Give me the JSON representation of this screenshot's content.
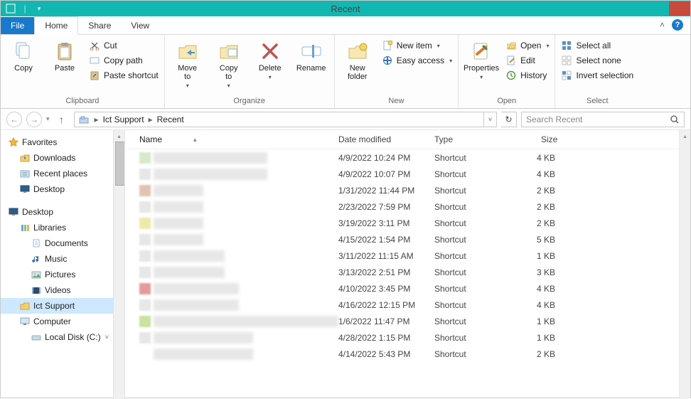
{
  "window": {
    "title": "Recent"
  },
  "tabs": {
    "file": "File",
    "home": "Home",
    "share": "Share",
    "view": "View"
  },
  "ribbon": {
    "clipboard": {
      "label": "Clipboard",
      "copy": "Copy",
      "paste": "Paste",
      "cut": "Cut",
      "copy_path": "Copy path",
      "paste_shortcut": "Paste shortcut"
    },
    "organize": {
      "label": "Organize",
      "move_to": "Move\nto",
      "copy_to": "Copy\nto",
      "delete": "Delete",
      "rename": "Rename"
    },
    "new": {
      "label": "New",
      "new_folder": "New\nfolder",
      "new_item": "New item",
      "easy_access": "Easy access"
    },
    "open": {
      "label": "Open",
      "properties": "Properties",
      "open": "Open",
      "edit": "Edit",
      "history": "History"
    },
    "select": {
      "label": "Select",
      "select_all": "Select all",
      "select_none": "Select none",
      "invert": "Invert selection"
    }
  },
  "breadcrumb": {
    "items": [
      "Ict Support",
      "Recent"
    ]
  },
  "search": {
    "placeholder": "Search Recent"
  },
  "tree": {
    "favorites": {
      "label": "Favorites",
      "items": [
        "Downloads",
        "Recent places",
        "Desktop"
      ]
    },
    "desktop": {
      "label": "Desktop",
      "libraries": {
        "label": "Libraries",
        "items": [
          "Documents",
          "Music",
          "Pictures",
          "Videos"
        ]
      },
      "ict": "Ict Support",
      "computer": {
        "label": "Computer",
        "items": [
          "Local Disk (C:)"
        ]
      }
    }
  },
  "columns": {
    "name": "Name",
    "date": "Date modified",
    "type": "Type",
    "size": "Size"
  },
  "rows": [
    {
      "date": "4/9/2022 10:24 PM",
      "type": "Shortcut",
      "size": "4 KB",
      "chip": "#d8e9c7",
      "nw": 160
    },
    {
      "date": "4/9/2022 10:07 PM",
      "type": "Shortcut",
      "size": "4 KB",
      "chip": "#e7e7e7",
      "nw": 160
    },
    {
      "date": "1/31/2022 11:44 PM",
      "type": "Shortcut",
      "size": "2 KB",
      "chip": "#e2c3b1",
      "nw": 70
    },
    {
      "date": "2/23/2022 7:59 PM",
      "type": "Shortcut",
      "size": "2 KB",
      "chip": "#e7e7e7",
      "nw": 70
    },
    {
      "date": "3/19/2022 3:11 PM",
      "type": "Shortcut",
      "size": "2 KB",
      "chip": "#eceaa8",
      "nw": 70
    },
    {
      "date": "4/15/2022 1:54 PM",
      "type": "Shortcut",
      "size": "5 KB",
      "chip": "#e7e7e7",
      "nw": 70
    },
    {
      "date": "3/11/2022 11:15 AM",
      "type": "Shortcut",
      "size": "1 KB",
      "chip": "#e7e7e7",
      "nw": 100
    },
    {
      "date": "3/13/2022 2:51 PM",
      "type": "Shortcut",
      "size": "3 KB",
      "chip": "#e7e7e7",
      "nw": 100
    },
    {
      "date": "4/10/2022 3:45 PM",
      "type": "Shortcut",
      "size": "4 KB",
      "chip": "#e29b9b",
      "nw": 120
    },
    {
      "date": "4/16/2022 12:15 PM",
      "type": "Shortcut",
      "size": "4 KB",
      "chip": "#e7e7e7",
      "nw": 120
    },
    {
      "date": "1/6/2022 11:47 PM",
      "type": "Shortcut",
      "size": "1 KB",
      "chip": "#c9e2a0",
      "nw": 260
    },
    {
      "date": "4/28/2022 1:15 PM",
      "type": "Shortcut",
      "size": "1 KB",
      "chip": "#e7e7e7",
      "nw": 140
    },
    {
      "date": "4/14/2022 5:43 PM",
      "type": "Shortcut",
      "size": "2 KB",
      "chip": "#e0c b0",
      "nw": 140
    }
  ]
}
